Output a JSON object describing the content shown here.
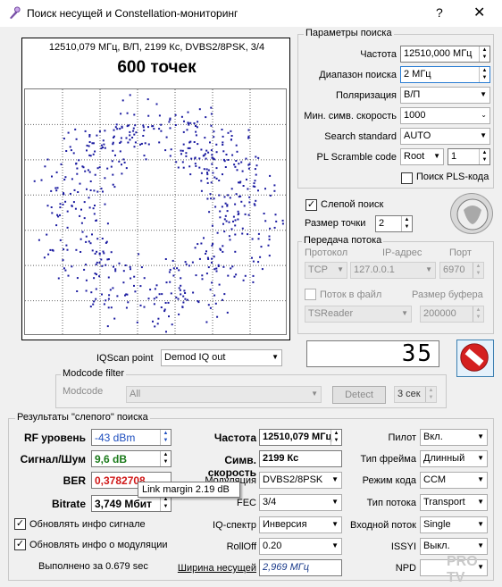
{
  "window": {
    "title": "Поиск несущей и Constellation-мониторинг",
    "help": "?",
    "close": "✕"
  },
  "plot": {
    "header": "12510,079 МГц, В/П, 2199 Кс, DVBS2/8PSK, 3/4",
    "points_label": "600 точек",
    "dot_color": "#1a1aa0",
    "dot_count": 600
  },
  "search_params": {
    "group_label": "Параметры поиска",
    "frequency_label": "Частота",
    "frequency_value": "12510,000 МГц",
    "range_label": "Диапазон поиска",
    "range_value": "2 МГц",
    "polarization_label": "Поляризация",
    "polarization_value": "В/П",
    "min_sr_label": "Мин. симв. скорость",
    "min_sr_value": "1000",
    "standard_label": "Search standard",
    "standard_value": "AUTO",
    "pls_label": "PL Scramble code",
    "pls_mode": "Root",
    "pls_value": "1",
    "pls_search_label": "Поиск PLS-кода"
  },
  "blind": {
    "label": "Слепой поиск",
    "checked": true,
    "point_size_label": "Размер точки",
    "point_size_value": "2"
  },
  "stream": {
    "group_label": "Передача потока",
    "protocol_label": "Протокол",
    "ip_label": "IP-адрес",
    "port_label": "Порт",
    "protocol_value": "TCP",
    "ip_value": "127.0.0.1",
    "port_value": "6970",
    "to_file_label": "Поток в файл",
    "buffer_label": "Размер буфера",
    "reader_value": "TSReader",
    "buffer_value": "200000"
  },
  "lcd_value": "35",
  "iqscan": {
    "label": "IQScan point",
    "value": "Demod IQ out"
  },
  "modcode": {
    "group_label": "Modcode filter",
    "label": "Modcode",
    "value": "All",
    "detect_label": "Detect",
    "time_value": "3 сек"
  },
  "results": {
    "group_label": "Результаты \"слепого\" поиска",
    "rf_label": "RF уровень",
    "rf_value": "-43 dBm",
    "snr_label": "Сигнал/Шум",
    "snr_value": "9,6 dB",
    "ber_label": "BER",
    "ber_value": "0,3782708",
    "bitrate_label": "Bitrate",
    "bitrate_value": "3,749 Мбит",
    "freq_label": "Частота",
    "freq_value": "12510,079 МГц",
    "sr_label": "Симв. скорость",
    "sr_value": "2199 Кс",
    "mod_label": "Модуляция",
    "mod_value": "DVBS2/8PSK",
    "fec_label": "FEC",
    "fec_value": "3/4",
    "iq_label": "IQ-спектр",
    "iq_value": "Инверсия",
    "rolloff_label": "RollOff",
    "rolloff_value": "0.20",
    "bw_label": "Ширина несущей",
    "bw_value": "2,969 МГц",
    "pilot_label": "Пилот",
    "pilot_value": "Вкл.",
    "frame_label": "Тип фрейма",
    "frame_value": "Длинный",
    "coding_label": "Режим кода",
    "coding_value": "CCM",
    "streamtype_label": "Тип потока",
    "streamtype_value": "Transport",
    "input_label": "Входной поток",
    "input_value": "Single",
    "issyi_label": "ISSYI",
    "issyi_value": "Выкл.",
    "npd_label": "NPD",
    "upd_signal_label": "Обновлять инфо сигнале",
    "upd_mod_label": "Обновлять инфо о модуляции",
    "done_label": "Выполнено за 0.679 sec"
  },
  "tooltip": "Link margin 2.19 dB",
  "colors": {
    "rf": "#1f4fbf",
    "snr": "#1a7a1a",
    "ber": "#d01818",
    "bw": "#1a3a8a"
  }
}
